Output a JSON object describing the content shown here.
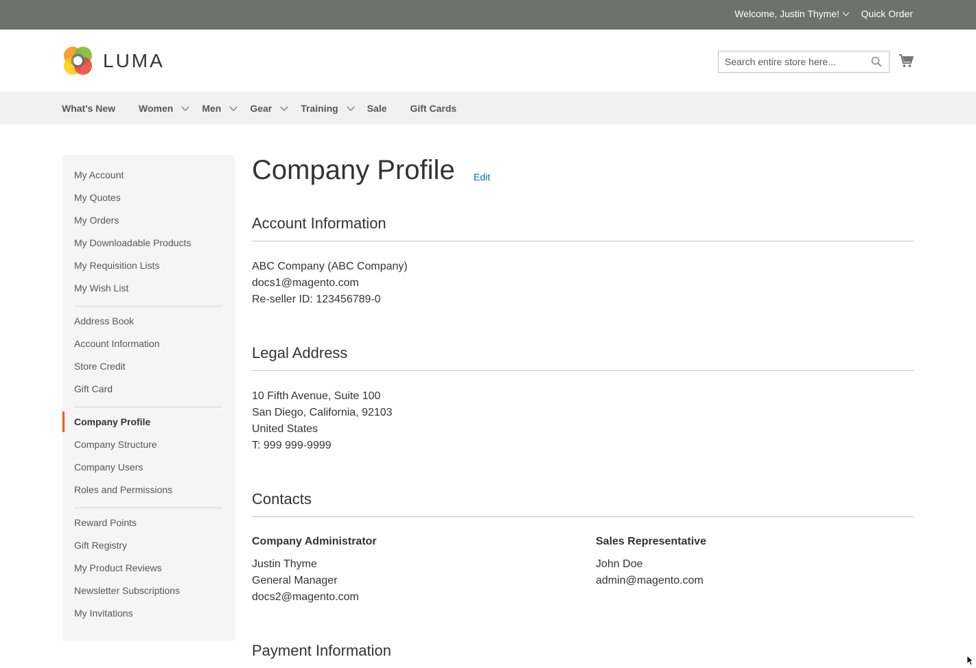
{
  "top_panel": {
    "welcome": "Welcome, Justin Thyme!",
    "quick_order": "Quick Order"
  },
  "header": {
    "logo_text": "LUMA",
    "search_placeholder": "Search entire store here...",
    "icons": {
      "search": "search-icon",
      "cart": "cart-icon"
    }
  },
  "nav": {
    "items": [
      {
        "label": "What's New"
      },
      {
        "label": "Women"
      },
      {
        "label": "Men"
      },
      {
        "label": "Gear"
      },
      {
        "label": "Training"
      },
      {
        "label": "Sale"
      },
      {
        "label": "Gift Cards"
      }
    ]
  },
  "sidebar": {
    "group1": [
      "My Account",
      "My Quotes",
      "My Orders",
      "My Downloadable Products",
      "My Requisition Lists",
      "My Wish List"
    ],
    "group2": [
      "Address Book",
      "Account Information",
      "Store Credit",
      "Gift Card"
    ],
    "group3": [
      "Company Profile",
      "Company Structure",
      "Company Users",
      "Roles and Permissions"
    ],
    "group4": [
      "Reward Points",
      "Gift Registry",
      "My Product Reviews",
      "Newsletter Subscriptions",
      "My Invitations"
    ],
    "active": "Company Profile",
    "accent_color": "#ff5501"
  },
  "main": {
    "title": "Company Profile",
    "edit": "Edit",
    "account_info": {
      "title": "Account Information",
      "lines": [
        "ABC Company (ABC Company)",
        "docs1@magento.com",
        "Re-seller ID: 123456789-0"
      ]
    },
    "legal_address": {
      "title": "Legal Address",
      "lines": [
        "10 Fifth Avenue, Suite 100",
        "San Diego, California, 92103",
        "United States",
        "T: 999 999-9999"
      ]
    },
    "contacts": {
      "title": "Contacts",
      "admin": {
        "title": "Company Administrator",
        "lines": [
          "Justin Thyme",
          "General Manager",
          "docs2@magento.com"
        ]
      },
      "sales": {
        "title": "Sales Representative",
        "lines": [
          "John Doe",
          "admin@magento.com"
        ]
      }
    },
    "payment": {
      "title": "Payment Information"
    }
  },
  "colors": {
    "top_panel": "#6e716e",
    "nav_bg": "#f0f0f0",
    "link": "#006bb4",
    "sidebar_bg": "#f5f5f5"
  }
}
